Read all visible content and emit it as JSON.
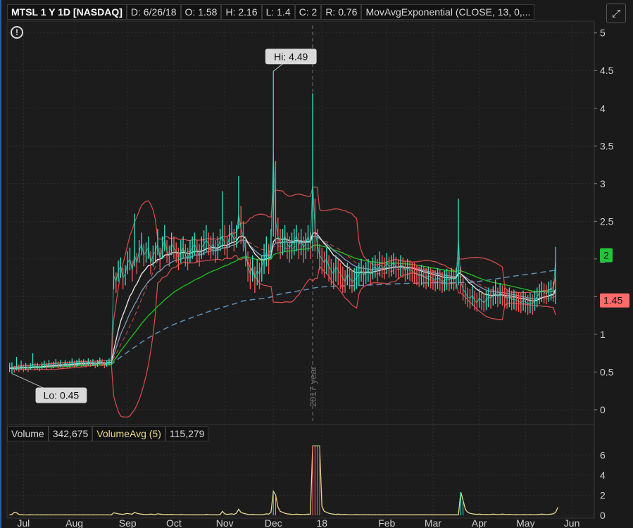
{
  "header": {
    "symbol": "MTSL 1 Y 1D [NASDAQ]",
    "date": "D: 6/26/18",
    "open": "O: 1.58",
    "high": "H: 2.16",
    "low": "L: 1.4",
    "close": "C: 2",
    "range": "R: 0.76",
    "study": "MovAvgExponential (CLOSE, 13, 0,..."
  },
  "volume_header": {
    "label": "Volume",
    "value": "342,675",
    "avg_label": "VolumeAvg (5)",
    "avg_value": "115,279"
  },
  "annotations": {
    "hi": "Hi: 4.49",
    "lo": "Lo: 0.45",
    "year_marker": "2017 year",
    "last_price": "1.45",
    "last_close": "2"
  },
  "colors": {
    "price_up": "#2ee6c8",
    "price_down": "#ff5a5a",
    "bollinger": "#d04a4a",
    "ema_short": "#e0e0e0",
    "ema_mid": "#7f8fb0",
    "ema_long": "#1fb81f",
    "sma_long": "#5f8fb5",
    "volume_line": "#e8d88a",
    "grid": "#2e2e2e"
  },
  "chart_data": {
    "type": "line",
    "price_axis": {
      "ticks": [
        0,
        0.5,
        1,
        1.5,
        2,
        2.5,
        3,
        3.5,
        4,
        4.5,
        5
      ],
      "ylim": [
        -0.15,
        5.1
      ]
    },
    "volume_axis": {
      "ticks": [
        0,
        2,
        4,
        6
      ],
      "ylim": [
        0,
        7
      ]
    },
    "x_ticks": [
      "Jul",
      "Aug",
      "Sep",
      "Oct",
      "Nov",
      "Dec",
      "18",
      "Feb",
      "Mar",
      "Apr",
      "May",
      "Jun"
    ],
    "x_tick_idx": [
      6,
      28,
      51,
      71,
      93,
      114,
      135,
      163,
      183,
      203,
      223,
      243
    ],
    "n_days": 252,
    "series": [
      {
        "name": "Close",
        "values": [
          0.55,
          0.56,
          0.54,
          0.57,
          0.55,
          0.58,
          0.56,
          0.57,
          0.55,
          0.58,
          0.6,
          0.57,
          0.58,
          0.56,
          0.59,
          0.6,
          0.58,
          0.61,
          0.59,
          0.6,
          0.62,
          0.6,
          0.61,
          0.59,
          0.62,
          0.6,
          0.61,
          0.63,
          0.61,
          0.62,
          0.64,
          0.62,
          0.63,
          0.61,
          0.64,
          0.62,
          0.63,
          0.6,
          0.62,
          0.65,
          0.63,
          0.6,
          0.62,
          0.64,
          0.66,
          1.78,
          1.7,
          1.85,
          1.9,
          1.75,
          1.8,
          1.95,
          2.0,
          1.85,
          2.05,
          1.95,
          2.1,
          2.2,
          2.05,
          2.1,
          2.15,
          1.95,
          2.05,
          2.1,
          2.2,
          2.0,
          2.15,
          2.25,
          2.1,
          2.05,
          2.2,
          2.15,
          2.1,
          2.0,
          2.1,
          2.15,
          2.05,
          2.0,
          2.1,
          2.15,
          2.2,
          2.1,
          2.05,
          2.15,
          2.2,
          2.25,
          2.2,
          2.15,
          2.2,
          2.1,
          2.15,
          2.25,
          2.3,
          2.2,
          2.15,
          2.3,
          2.35,
          2.25,
          2.3,
          2.6,
          2.4,
          2.3,
          2.1,
          1.9,
          1.8,
          1.9,
          1.75,
          1.85,
          1.8,
          1.9,
          2.0,
          2.1,
          2.0,
          2.2,
          3.4,
          2.5,
          2.3,
          2.2,
          2.25,
          2.3,
          2.2,
          2.15,
          2.2,
          2.25,
          2.3,
          2.2,
          2.25,
          2.15,
          2.2,
          2.3,
          2.2,
          3.0,
          2.4,
          2.2,
          2.05,
          2.0,
          1.95,
          2.0,
          1.9,
          1.85,
          1.8,
          1.9,
          1.85,
          1.8,
          1.75,
          1.7,
          1.8,
          1.75,
          1.7,
          1.72,
          1.75,
          1.8,
          1.85,
          1.78,
          1.82,
          1.85,
          1.8,
          1.88,
          1.9,
          1.85,
          1.92,
          1.9,
          1.88,
          1.95,
          1.9,
          1.92,
          1.95,
          1.9,
          1.88,
          1.92,
          1.9,
          1.85,
          1.88,
          1.86,
          1.84,
          1.82,
          1.8,
          1.78,
          1.8,
          1.77,
          1.75,
          1.78,
          1.76,
          1.74,
          1.72,
          1.75,
          1.73,
          1.7,
          1.72,
          1.74,
          1.72,
          1.75,
          1.73,
          1.75,
          2.25,
          1.7,
          1.6,
          1.55,
          1.5,
          1.48,
          1.52,
          1.45,
          1.42,
          1.48,
          1.45,
          1.42,
          1.45,
          1.5,
          1.48,
          1.52,
          1.55,
          1.5,
          1.55,
          1.52,
          1.5,
          1.48,
          1.5,
          1.46,
          1.47,
          1.45,
          1.44,
          1.42,
          1.45,
          1.43,
          1.4,
          1.42,
          1.4,
          1.45,
          1.5,
          1.55,
          1.58,
          1.56,
          1.54,
          1.58,
          1.6,
          1.58,
          2.0
        ]
      },
      {
        "name": "High",
        "values": [
          0.62,
          0.63,
          0.58,
          0.7,
          0.6,
          0.65,
          0.6,
          0.62,
          0.6,
          0.62,
          0.75,
          0.62,
          0.62,
          0.6,
          0.63,
          0.65,
          0.62,
          0.66,
          0.63,
          0.64,
          0.67,
          0.64,
          0.66,
          0.63,
          0.66,
          0.64,
          0.65,
          0.68,
          0.65,
          0.66,
          0.68,
          0.66,
          0.67,
          0.65,
          0.68,
          0.66,
          0.67,
          0.64,
          0.66,
          0.69,
          0.67,
          0.64,
          0.66,
          0.68,
          0.7,
          1.9,
          1.82,
          1.98,
          2.02,
          1.88,
          1.92,
          2.1,
          2.15,
          1.98,
          2.6,
          2.08,
          2.25,
          2.35,
          2.2,
          2.22,
          2.3,
          2.1,
          2.18,
          2.22,
          2.4,
          2.15,
          2.3,
          2.45,
          2.25,
          2.18,
          2.35,
          2.3,
          2.22,
          2.15,
          2.25,
          2.3,
          2.2,
          2.15,
          2.25,
          2.3,
          2.35,
          2.25,
          2.2,
          2.3,
          2.38,
          2.45,
          2.35,
          2.3,
          2.35,
          2.25,
          2.3,
          2.4,
          2.9,
          2.45,
          2.3,
          2.45,
          2.5,
          2.4,
          2.45,
          3.1,
          2.7,
          2.5,
          2.3,
          2.1,
          2.0,
          2.05,
          1.9,
          2.0,
          1.95,
          2.05,
          2.2,
          2.3,
          2.2,
          2.4,
          4.49,
          3.3,
          2.55,
          2.4,
          2.4,
          2.45,
          2.35,
          2.3,
          2.35,
          2.4,
          2.45,
          2.35,
          2.4,
          2.3,
          2.35,
          2.45,
          2.35,
          4.2,
          2.8,
          2.4,
          2.2,
          2.15,
          2.1,
          2.15,
          2.05,
          2.0,
          1.95,
          2.05,
          2.0,
          1.95,
          1.9,
          1.85,
          1.95,
          1.9,
          1.85,
          1.88,
          1.9,
          1.95,
          2.0,
          1.92,
          1.96,
          2.0,
          1.95,
          2.02,
          2.05,
          2.0,
          2.1,
          2.05,
          2.02,
          2.08,
          2.03,
          2.05,
          2.08,
          2.03,
          2.0,
          2.05,
          2.02,
          1.98,
          2.0,
          1.98,
          1.96,
          1.95,
          1.92,
          1.9,
          1.92,
          1.9,
          1.88,
          1.9,
          1.88,
          1.86,
          1.85,
          1.88,
          1.86,
          1.83,
          1.85,
          1.87,
          1.85,
          1.88,
          1.86,
          1.88,
          2.8,
          1.9,
          1.75,
          1.68,
          1.62,
          1.6,
          1.65,
          1.58,
          1.55,
          1.6,
          1.58,
          1.55,
          1.58,
          1.62,
          1.6,
          1.64,
          1.72,
          1.62,
          1.68,
          1.65,
          1.62,
          1.6,
          1.62,
          1.58,
          1.59,
          1.57,
          1.56,
          1.55,
          1.58,
          1.56,
          1.52,
          1.55,
          1.53,
          1.58,
          1.62,
          1.67,
          1.7,
          1.68,
          1.66,
          1.7,
          1.72,
          1.7,
          2.16
        ]
      },
      {
        "name": "Low",
        "values": [
          0.5,
          0.48,
          0.49,
          0.52,
          0.5,
          0.53,
          0.5,
          0.52,
          0.5,
          0.53,
          0.55,
          0.52,
          0.53,
          0.51,
          0.54,
          0.55,
          0.53,
          0.56,
          0.54,
          0.55,
          0.57,
          0.55,
          0.56,
          0.54,
          0.57,
          0.55,
          0.56,
          0.58,
          0.56,
          0.57,
          0.59,
          0.57,
          0.58,
          0.56,
          0.59,
          0.57,
          0.58,
          0.55,
          0.57,
          0.6,
          0.58,
          0.55,
          0.57,
          0.59,
          0.6,
          1.6,
          1.55,
          1.7,
          1.75,
          1.6,
          1.65,
          1.8,
          1.85,
          1.7,
          1.9,
          1.8,
          1.95,
          2.05,
          1.9,
          1.95,
          2.0,
          1.8,
          1.9,
          1.95,
          2.05,
          1.85,
          2.0,
          2.1,
          1.95,
          1.9,
          2.05,
          2.0,
          1.95,
          1.85,
          1.95,
          2.0,
          1.9,
          1.85,
          1.95,
          2.0,
          2.05,
          1.95,
          1.9,
          2.0,
          2.05,
          2.1,
          2.05,
          2.0,
          2.05,
          1.95,
          2.0,
          2.1,
          2.15,
          2.05,
          2.0,
          2.15,
          2.2,
          2.1,
          2.15,
          2.4,
          2.2,
          2.1,
          1.9,
          1.7,
          1.6,
          1.7,
          1.55,
          1.65,
          1.6,
          1.7,
          1.8,
          1.9,
          1.8,
          2.0,
          2.3,
          2.2,
          2.1,
          2.0,
          2.05,
          2.1,
          2.0,
          1.95,
          2.0,
          2.05,
          2.1,
          2.0,
          2.05,
          1.95,
          2.0,
          2.1,
          2.0,
          2.1,
          2.1,
          2.0,
          1.85,
          1.8,
          1.75,
          1.8,
          1.7,
          1.65,
          1.6,
          1.7,
          1.65,
          1.6,
          1.55,
          1.55,
          1.65,
          1.6,
          1.55,
          1.57,
          1.6,
          1.65,
          1.7,
          1.63,
          1.67,
          1.7,
          1.65,
          1.73,
          1.75,
          1.7,
          1.77,
          1.75,
          1.73,
          1.8,
          1.75,
          1.77,
          1.8,
          1.75,
          1.73,
          1.77,
          1.75,
          1.7,
          1.73,
          1.71,
          1.69,
          1.67,
          1.65,
          1.63,
          1.65,
          1.62,
          1.6,
          1.63,
          1.61,
          1.59,
          1.57,
          1.6,
          1.58,
          1.55,
          1.57,
          1.59,
          1.57,
          1.6,
          1.58,
          1.6,
          1.65,
          1.55,
          1.45,
          1.4,
          1.36,
          1.34,
          1.38,
          1.32,
          1.3,
          1.35,
          1.32,
          1.3,
          1.32,
          1.36,
          1.34,
          1.38,
          1.4,
          1.36,
          1.4,
          1.38,
          1.36,
          1.34,
          1.36,
          1.32,
          1.33,
          1.31,
          1.3,
          1.28,
          1.31,
          1.29,
          1.26,
          1.28,
          1.26,
          1.31,
          1.36,
          1.4,
          1.43,
          1.41,
          1.4,
          1.43,
          1.45,
          1.43,
          1.4
        ]
      },
      {
        "name": "Volume",
        "values": [
          0.05,
          0.08,
          0.3,
          0.25,
          0.1,
          0.08,
          0.05,
          0.04,
          0.05,
          0.06,
          0.05,
          0.04,
          0.05,
          0.04,
          0.05,
          0.04,
          0.05,
          0.04,
          0.05,
          0.04,
          0.05,
          0.04,
          0.05,
          0.04,
          0.05,
          0.04,
          0.05,
          0.04,
          0.05,
          0.04,
          0.05,
          0.04,
          0.05,
          0.04,
          0.05,
          0.04,
          0.05,
          0.04,
          0.05,
          0.04,
          0.05,
          0.04,
          0.05,
          0.04,
          0.05,
          0.25,
          0.2,
          0.15,
          0.12,
          0.1,
          0.15,
          0.18,
          0.14,
          0.12,
          0.3,
          0.2,
          0.15,
          0.12,
          0.1,
          0.08,
          0.1,
          0.12,
          0.1,
          0.08,
          0.15,
          0.12,
          0.1,
          0.08,
          0.1,
          0.08,
          0.1,
          0.08,
          0.07,
          0.06,
          0.08,
          0.07,
          0.06,
          0.05,
          0.06,
          0.05,
          0.06,
          0.05,
          0.06,
          0.05,
          0.06,
          0.1,
          0.08,
          0.06,
          0.05,
          0.06,
          0.05,
          0.08,
          0.4,
          0.15,
          0.1,
          0.12,
          0.15,
          0.1,
          0.2,
          0.6,
          0.3,
          0.2,
          0.15,
          0.1,
          0.08,
          0.1,
          0.08,
          0.07,
          0.06,
          0.08,
          0.1,
          0.15,
          0.12,
          0.3,
          2.4,
          2.0,
          0.8,
          0.4,
          0.3,
          0.2,
          0.15,
          0.12,
          0.1,
          0.1,
          0.12,
          0.1,
          0.1,
          0.08,
          0.1,
          0.12,
          0.1,
          6.9,
          6.9,
          6.9,
          6.9,
          0.9,
          0.4,
          0.3,
          0.2,
          0.15,
          0.12,
          0.1,
          0.12,
          0.1,
          0.08,
          0.1,
          0.08,
          0.07,
          0.06,
          0.07,
          0.08,
          0.07,
          0.06,
          0.07,
          0.06,
          0.07,
          0.06,
          0.05,
          0.06,
          0.05,
          0.06,
          0.05,
          0.06,
          0.05,
          0.06,
          0.05,
          0.06,
          0.05,
          0.06,
          0.05,
          0.06,
          0.05,
          0.06,
          0.05,
          0.06,
          0.05,
          0.06,
          0.05,
          0.06,
          0.05,
          0.06,
          0.05,
          0.06,
          0.05,
          0.06,
          0.05,
          0.06,
          0.05,
          0.06,
          0.05,
          0.06,
          0.05,
          0.06,
          0.05,
          0.06,
          2.3,
          1.5,
          0.6,
          0.3,
          0.2,
          0.15,
          0.12,
          0.1,
          0.12,
          0.1,
          0.08,
          0.1,
          0.08,
          0.1,
          0.12,
          0.1,
          0.08,
          0.1,
          0.12,
          0.1,
          0.08,
          0.1,
          0.08,
          0.07,
          0.08,
          0.07,
          0.06,
          0.08,
          0.07,
          0.06,
          0.08,
          0.07,
          0.06,
          0.08,
          0.1,
          0.12,
          0.1,
          0.08,
          0.1,
          0.12,
          0.15,
          0.3,
          0.8
        ]
      }
    ]
  }
}
